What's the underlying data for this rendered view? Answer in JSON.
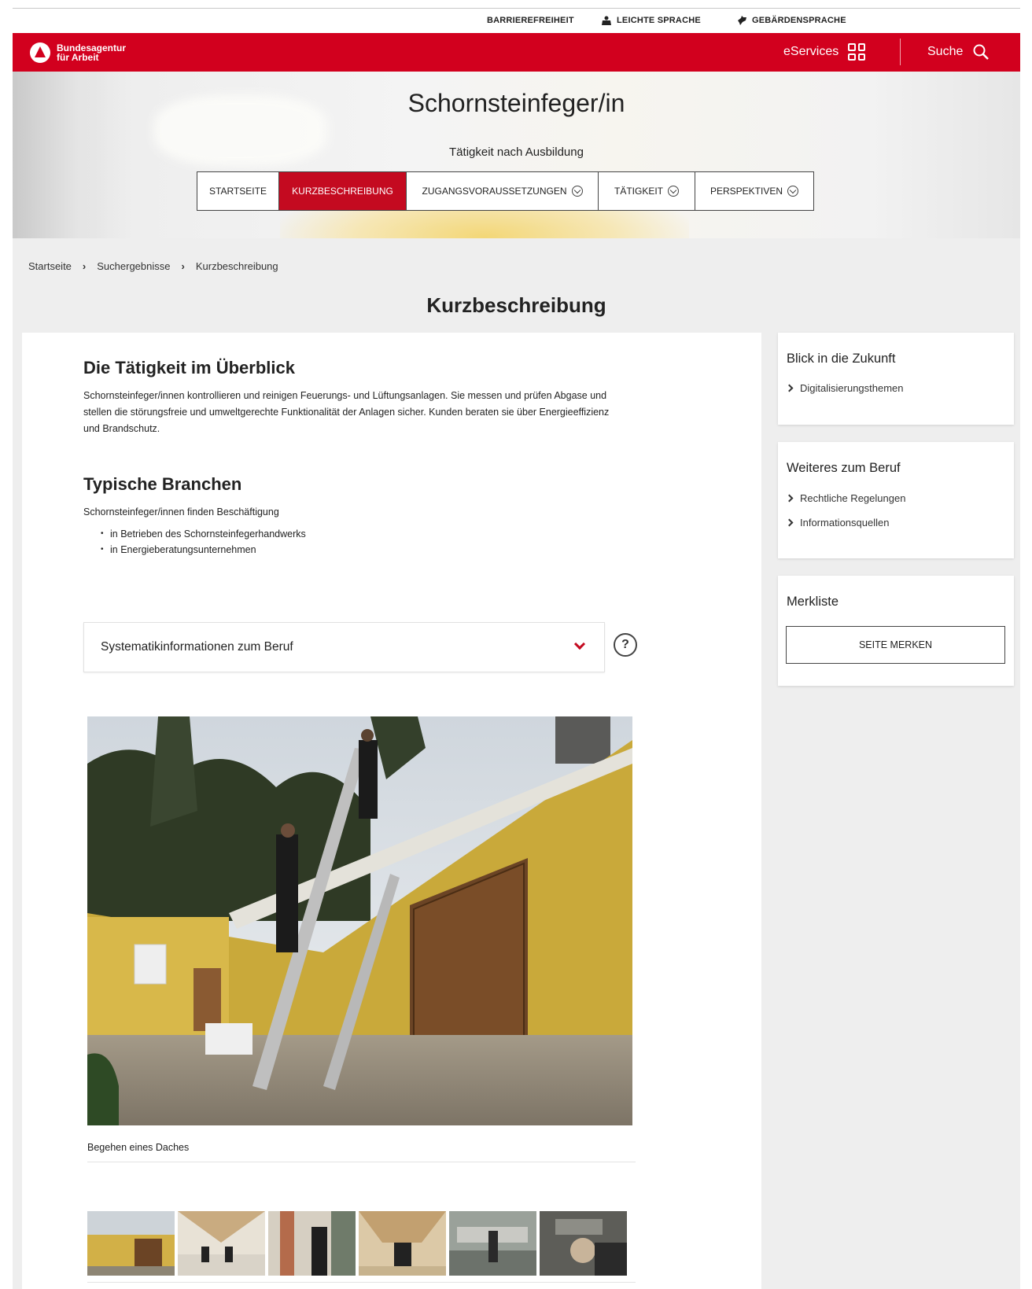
{
  "utility": {
    "accessibility": "BARRIEREFREIHEIT",
    "easy_language": "LEICHTE SPRACHE",
    "sign_language": "GEBÄRDENSPRACHE"
  },
  "header": {
    "logo_line1": "Bundesagentur",
    "logo_line2": "für Arbeit",
    "eservices": "eServices",
    "search": "Suche"
  },
  "hero": {
    "title": "Schornsteinfeger/in",
    "subtitle": "Tätigkeit nach Ausbildung",
    "tabs": [
      {
        "label": "STARTSEITE",
        "active": false,
        "dropdown": false
      },
      {
        "label": "KURZBESCHREIBUNG",
        "active": true,
        "dropdown": false
      },
      {
        "label": "ZUGANGSVORAUSSETZUNGEN",
        "active": false,
        "dropdown": true
      },
      {
        "label": "TÄTIGKEIT",
        "active": false,
        "dropdown": true
      },
      {
        "label": "PERSPEKTIVEN",
        "active": false,
        "dropdown": true
      }
    ]
  },
  "breadcrumb": [
    "Startseite",
    "Suchergebnisse",
    "Kurzbeschreibung"
  ],
  "page_heading": "Kurzbeschreibung",
  "main": {
    "overview_heading": "Die Tätigkeit im Überblick",
    "overview_text": "Schornsteinfeger/innen kontrollieren und reinigen Feuerungs- und Lüftungsanlagen. Sie messen und prüfen Abgase und stellen die störungsfreie und umweltgerechte Funktionalität der Anlagen sicher. Kunden beraten sie über Energieeffizienz und Brandschutz.",
    "branchen_heading": "Typische Branchen",
    "branchen_intro": "Schornsteinfeger/innen finden Beschäftigung",
    "branchen_items": [
      "in Betrieben des Schornsteinfegerhandwerks",
      "in Energieberatungsunternehmen"
    ],
    "accordion_label": "Systematikinformationen zum Beruf",
    "help_symbol": "?",
    "image_caption": "Begehen eines Daches"
  },
  "sidebar": {
    "future_title": "Blick in die Zukunft",
    "future_links": [
      "Digitalisierungsthemen"
    ],
    "more_title": "Weiteres zum Beruf",
    "more_links": [
      "Rechtliche Regelungen",
      "Informationsquellen"
    ],
    "merk_title": "Merkliste",
    "merk_button": "SEITE MERKEN"
  },
  "colors": {
    "brand_red": "#d2001e",
    "active_tab": "#c40a20",
    "page_grey": "#eeeeee"
  }
}
